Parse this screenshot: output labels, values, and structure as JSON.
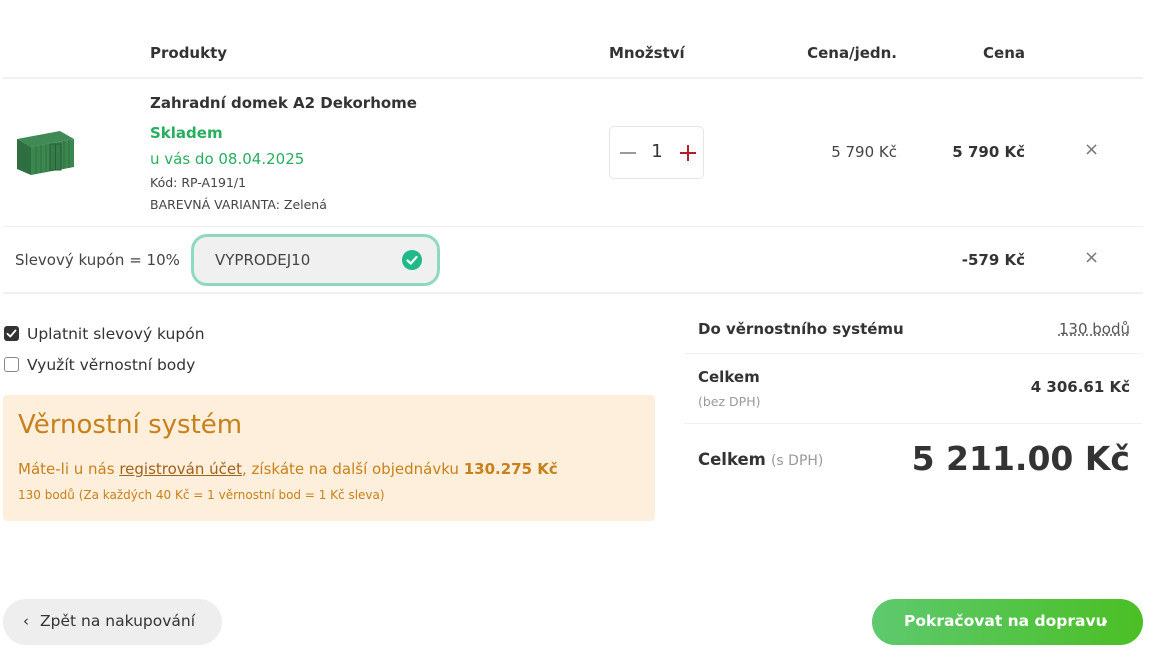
{
  "table_header": {
    "products": "Produkty",
    "quantity": "Množství",
    "unit_price": "Cena/jedn.",
    "price": "Cena"
  },
  "item": {
    "name": "Zahradní domek A2 Dekorhome",
    "stock": "Skladem",
    "delivery": "u vás do 08.04.2025",
    "code": "Kód: RP-A191/1",
    "variant": "BAREVNÁ VARIANTA: Zelená",
    "quantity": "1",
    "unit_price": "5 790 Kč",
    "price": "5 790 Kč",
    "remove": "×",
    "image_icon": "garden-shed-image"
  },
  "coupon": {
    "label": "Slevový kupón = 10%",
    "code": "VYPRODEJ10",
    "discount": "-579 Kč",
    "remove": "×",
    "status_color": "#20b989"
  },
  "options": {
    "apply_coupon": {
      "label": "Uplatnit slevový kupón",
      "checked": true
    },
    "use_points": {
      "label": "Využít věrnostní body",
      "checked": false
    }
  },
  "loyalty": {
    "title": "Věrnostní systém",
    "text_before": "Máte-li u nás ",
    "link": "registrován účet",
    "text_after": ", získáte na další objednávku ",
    "amount": "130.275 Kč",
    "note": "130 bodů (Za každých 40 Kč = 1 věrnostní bod = 1 Kč sleva)"
  },
  "summary": {
    "loyalty_label": "Do věrnostního systému",
    "loyalty_points": "130 bodů",
    "total_label": "Celkem",
    "total_sub": "(bez DPH)",
    "total_value": "4 306.61 Kč",
    "grand_label": "Celkem",
    "grand_sub": "(s DPH)",
    "grand_value": "5 211.00 Kč"
  },
  "buttons": {
    "back": "Zpět na nakupování",
    "next": "Pokračovat na dopravu",
    "back_chevron": "‹",
    "next_chevron": "›"
  },
  "colors": {
    "green_accent": "#27ae60",
    "loyalty_bg": "#fdefdb",
    "loyalty_text": "#c8801a",
    "next_button": "#4bbf24",
    "plus_color": "#b2202c"
  }
}
